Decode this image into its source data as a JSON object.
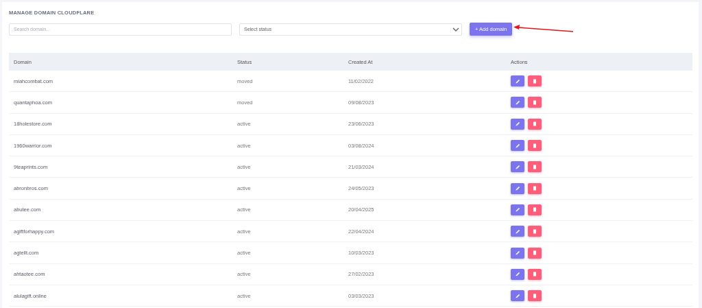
{
  "title": "MANAGE DOMAIN CLOUDFLARE",
  "search": {
    "placeholder": "Search domain..."
  },
  "status_select": {
    "placeholder": "Select status"
  },
  "add_button": {
    "label": "+ Add domain"
  },
  "table": {
    "columns": [
      "Domain",
      "Status",
      "Created At",
      "Actions"
    ],
    "rows": [
      {
        "domain": "miahcombat.com",
        "status": "moved",
        "created": "11/02/2022"
      },
      {
        "domain": "quantaphoa.com",
        "status": "moved",
        "created": "09/08/2023"
      },
      {
        "domain": "18holestore.com",
        "status": "active",
        "created": "23/06/2023"
      },
      {
        "domain": "1960warrior.com",
        "status": "active",
        "created": "03/08/2024"
      },
      {
        "domain": "9teaprints.com",
        "status": "active",
        "created": "21/03/2024"
      },
      {
        "domain": "abronbros.com",
        "status": "active",
        "created": "24/05/2023"
      },
      {
        "domain": "abutee.com",
        "status": "active",
        "created": "20/04/2025"
      },
      {
        "domain": "agiftforhappy.com",
        "status": "active",
        "created": "22/04/2024"
      },
      {
        "domain": "agtellt.com",
        "status": "active",
        "created": "10/03/2023"
      },
      {
        "domain": "ahtaotee.com",
        "status": "active",
        "created": "27/02/2023"
      },
      {
        "domain": "alulagift.online",
        "status": "active",
        "created": "03/03/2023"
      }
    ]
  }
}
